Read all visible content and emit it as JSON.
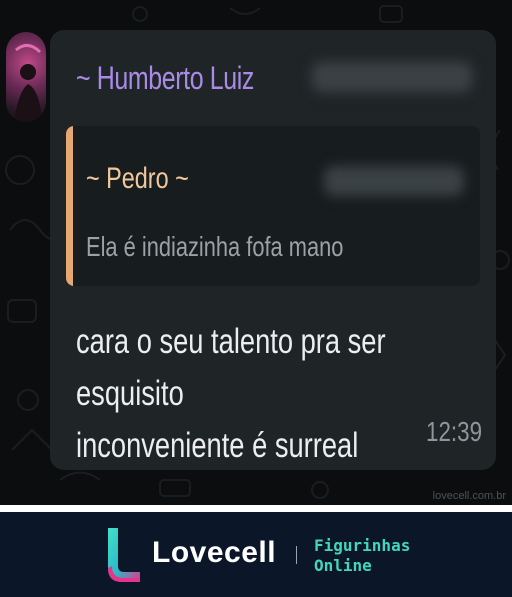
{
  "chat": {
    "sender_name": "~ Humberto Luiz",
    "quoted": {
      "author": "~ Pedro ~",
      "text": "Ela é indiazinha fofa mano"
    },
    "message_text": "cara o seu talento pra ser esquisito\ninconveniente é surreal",
    "time": "12:39",
    "watermark": "lovecell.com.br"
  },
  "footer": {
    "brand_name": "Lovecell",
    "tagline": "Figurinhas\nOnline"
  },
  "colors": {
    "chat_background": "#0b0d0e",
    "bubble": "#1f2527",
    "sender": "#a98be6",
    "quote_bar": "#e5a872",
    "quote_author": "#f1c79d",
    "footer_background": "#0b1729",
    "tagline": "#42d6bf"
  }
}
